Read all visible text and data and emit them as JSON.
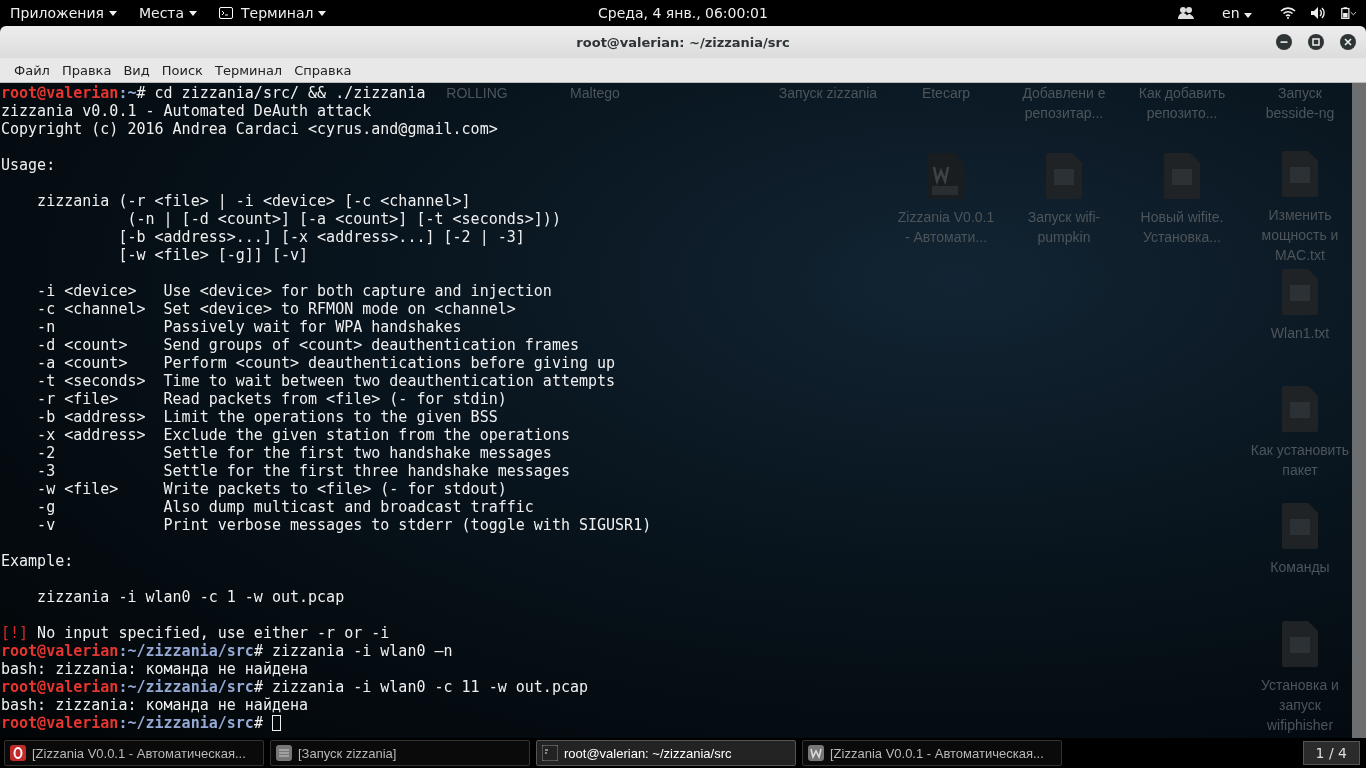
{
  "top_bar": {
    "menus": [
      "Приложения",
      "Места",
      "Терминал"
    ],
    "clock": "Среда,  4 янв., 06:00:01",
    "language": "en"
  },
  "window": {
    "title": "root@valerian: ~/zizzania/src",
    "menu": [
      "Файл",
      "Правка",
      "Вид",
      "Поиск",
      "Терминал",
      "Справка"
    ]
  },
  "terminal": {
    "blocks": [
      [
        {
          "segments": [
            {
              "kind": "user",
              "text": "root@valerian"
            },
            {
              "kind": "path",
              "text": ":~"
            },
            {
              "kind": "text",
              "text": "# cd zizzania/src/ && ./zizzania"
            }
          ]
        },
        {
          "segments": [
            {
              "kind": "text",
              "text": "zizzania v0.0.1 - Automated DeAuth attack"
            }
          ]
        },
        {
          "segments": [
            {
              "kind": "text",
              "text": "Copyright (c) 2016 Andrea Cardaci <cyrus.and@gmail.com>"
            }
          ]
        }
      ],
      [
        {
          "segments": [
            {
              "kind": "text",
              "text": "Usage:"
            }
          ]
        }
      ],
      [
        {
          "segments": [
            {
              "kind": "text",
              "text": "    zizzania (-r <file> | -i <device> [-c <channel>]"
            }
          ]
        },
        {
          "segments": [
            {
              "kind": "text",
              "text": "              (-n | [-d <count>] [-a <count>] [-t <seconds>]))"
            }
          ]
        },
        {
          "segments": [
            {
              "kind": "text",
              "text": "             [-b <address>...] [-x <address>...] [-2 | -3]"
            }
          ]
        },
        {
          "segments": [
            {
              "kind": "text",
              "text": "             [-w <file> [-g]] [-v]"
            }
          ]
        }
      ],
      [
        {
          "segments": [
            {
              "kind": "text",
              "text": "    -i <device>   Use <device> for both capture and injection"
            }
          ]
        },
        {
          "segments": [
            {
              "kind": "text",
              "text": "    -c <channel>  Set <device> to RFMON mode on <channel>"
            }
          ]
        },
        {
          "segments": [
            {
              "kind": "text",
              "text": "    -n            Passively wait for WPA handshakes"
            }
          ]
        },
        {
          "segments": [
            {
              "kind": "text",
              "text": "    -d <count>    Send groups of <count> deauthentication frames"
            }
          ]
        },
        {
          "segments": [
            {
              "kind": "text",
              "text": "    -a <count>    Perform <count> deauthentications before giving up"
            }
          ]
        },
        {
          "segments": [
            {
              "kind": "text",
              "text": "    -t <seconds>  Time to wait between two deauthentication attempts"
            }
          ]
        },
        {
          "segments": [
            {
              "kind": "text",
              "text": "    -r <file>     Read packets from <file> (- for stdin)"
            }
          ]
        },
        {
          "segments": [
            {
              "kind": "text",
              "text": "    -b <address>  Limit the operations to the given BSS"
            }
          ]
        },
        {
          "segments": [
            {
              "kind": "text",
              "text": "    -x <address>  Exclude the given station from the operations"
            }
          ]
        },
        {
          "segments": [
            {
              "kind": "text",
              "text": "    -2            Settle for the first two handshake messages"
            }
          ]
        },
        {
          "segments": [
            {
              "kind": "text",
              "text": "    -3            Settle for the first three handshake messages"
            }
          ]
        },
        {
          "segments": [
            {
              "kind": "text",
              "text": "    -w <file>     Write packets to <file> (- for stdout)"
            }
          ]
        },
        {
          "segments": [
            {
              "kind": "text",
              "text": "    -g            Also dump multicast and broadcast traffic"
            }
          ]
        },
        {
          "segments": [
            {
              "kind": "text",
              "text": "    -v            Print verbose messages to stderr (toggle with SIGUSR1)"
            }
          ]
        }
      ],
      [
        {
          "segments": [
            {
              "kind": "text",
              "text": "Example:"
            }
          ]
        }
      ],
      [
        {
          "segments": [
            {
              "kind": "text",
              "text": "    zizzania -i wlan0 -c 1 -w out.pcap"
            }
          ]
        }
      ],
      [
        {
          "segments": [
            {
              "kind": "error",
              "text": "[!]"
            },
            {
              "kind": "text",
              "text": " No input specified, use either -r or -i"
            }
          ]
        },
        {
          "segments": [
            {
              "kind": "user",
              "text": "root@valerian"
            },
            {
              "kind": "path",
              "text": ":~/zizzania/src"
            },
            {
              "kind": "text",
              "text": "# zizzania -i wlan0 –n"
            }
          ]
        },
        {
          "segments": [
            {
              "kind": "text",
              "text": "bash: zizzania: команда не найдена"
            }
          ]
        },
        {
          "segments": [
            {
              "kind": "user",
              "text": "root@valerian"
            },
            {
              "kind": "path",
              "text": ":~/zizzania/src"
            },
            {
              "kind": "text",
              "text": "# zizzania -i wlan0 -c 11 -w out.pcap"
            }
          ]
        },
        {
          "segments": [
            {
              "kind": "text",
              "text": "bash: zizzania: команда не найдена"
            }
          ]
        },
        {
          "cursor": true,
          "segments": [
            {
              "kind": "user",
              "text": "root@valerian"
            },
            {
              "kind": "path",
              "text": ":~/zizzania/src"
            },
            {
              "kind": "text",
              "text": "# "
            }
          ]
        }
      ]
    ]
  },
  "desktop": {
    "columns": [
      [
        {
          "kind": "label",
          "label": "ROLLING"
        }
      ],
      [
        {
          "kind": "label",
          "label": "Maltego"
        }
      ],
      [
        {
          "kind": "label",
          "label": "Запуск zizzania"
        }
      ],
      [
        {
          "kind": "label",
          "label": "Etecarp"
        },
        {
          "kind": "doc",
          "label": "Zizzania V0.0.1 - Автомати..."
        }
      ],
      [
        {
          "kind": "label",
          "label": "Добавлени е репозитар..."
        },
        {
          "kind": "file",
          "label": "Запуск wifi-pumpkin"
        }
      ],
      [
        {
          "kind": "label",
          "label": "Как добавить репозито..."
        },
        {
          "kind": "file",
          "label": "Новый wifite. Установка..."
        }
      ],
      [
        {
          "kind": "label",
          "label": "Запуск besside-ng"
        },
        {
          "kind": "file",
          "label": "Изменить мощность и MAC.txt"
        },
        {
          "kind": "file",
          "label": "Wlan1.txt"
        },
        {
          "kind": "file",
          "label": "Как установить пакет"
        },
        {
          "kind": "file",
          "label": "Команды"
        },
        {
          "kind": "file",
          "label": "Установка и запуск wifiphisher"
        }
      ]
    ]
  },
  "taskbar": {
    "items": [
      {
        "kind": "browser",
        "label": "[Zizzania V0.0.1 - Автоматическая...",
        "selected": false
      },
      {
        "kind": "editor",
        "label": "[Запуск zizzania]",
        "selected": false
      },
      {
        "kind": "terminal",
        "label": "root@valerian: ~/zizzania/src",
        "selected": true
      },
      {
        "kind": "writer",
        "label": "[Zizzania V0.0.1 - Автоматическая...",
        "selected": false
      }
    ],
    "workspace": "1 / 4"
  }
}
